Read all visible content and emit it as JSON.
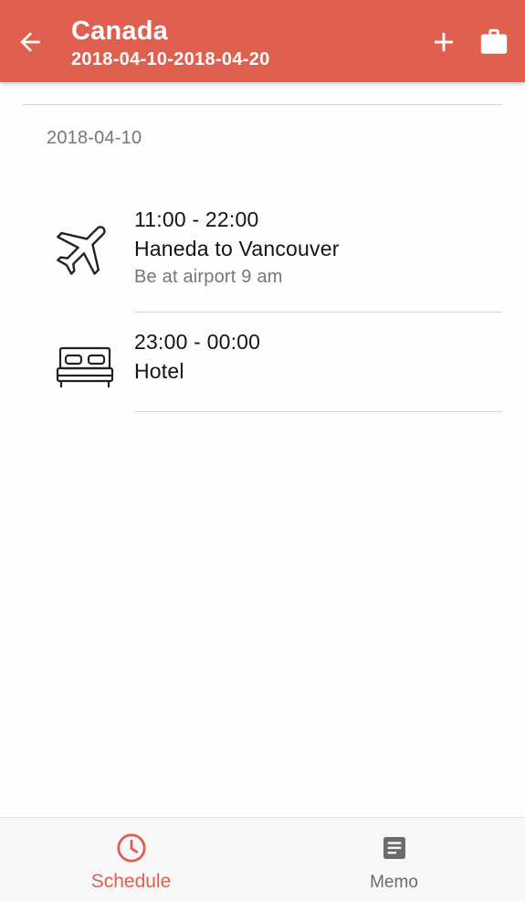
{
  "appbar": {
    "title": "Canada",
    "subtitle": "2018-04-10-2018-04-20",
    "background": "#e06050"
  },
  "schedule": {
    "date": "2018-04-10",
    "events": [
      {
        "icon": "airplane-icon",
        "time": "11:00 - 22:00",
        "title": "Haneda to Vancouver",
        "note": "Be at airport 9 am"
      },
      {
        "icon": "bed-icon",
        "time": "23:00 - 00:00",
        "title": "Hotel",
        "note": ""
      }
    ]
  },
  "bottom_nav": {
    "items": [
      {
        "label": "Schedule",
        "icon": "clock-icon",
        "active": true,
        "color": "#e06050"
      },
      {
        "label": "Memo",
        "icon": "memo-icon",
        "active": false,
        "color": "#6b6b6b"
      }
    ]
  }
}
